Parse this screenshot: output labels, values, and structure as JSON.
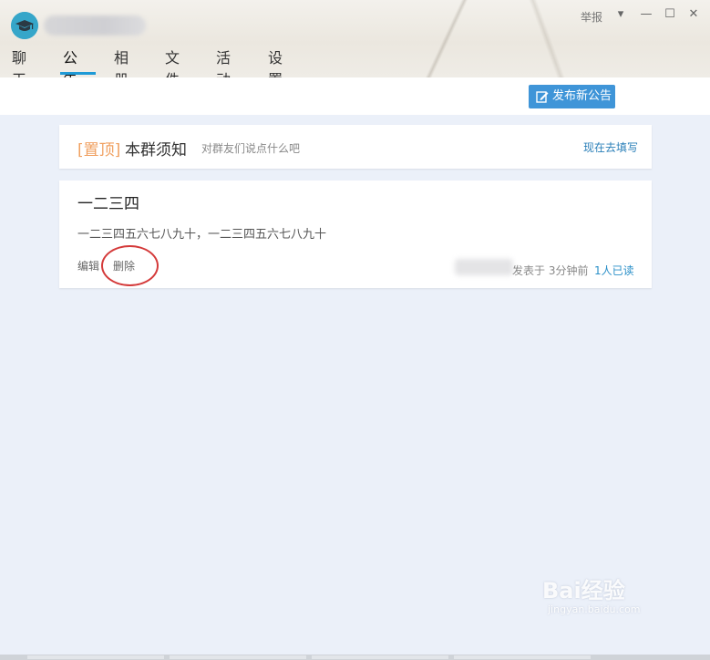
{
  "titlebar": {
    "report_label": "举报",
    "controls": {
      "dropdown": "▾",
      "minimize": "—",
      "maximize": "☐",
      "close": "✕"
    }
  },
  "tabs": [
    {
      "label": "聊天"
    },
    {
      "label": "公告"
    },
    {
      "label": "相册"
    },
    {
      "label": "文件"
    },
    {
      "label": "活动"
    },
    {
      "label": "设置"
    }
  ],
  "active_tab": "公告",
  "toolbar": {
    "publish_label": "发布新公告"
  },
  "pinned": {
    "tag": "[置顶]",
    "title": "本群须知",
    "hint": "对群友们说点什么吧",
    "fill_link": "现在去填写"
  },
  "notice": {
    "title": "一二三四",
    "body": "一二三四五六七八九十，一二三四五六七八九十",
    "edit_label": "编辑",
    "delete_label": "删除",
    "posted": "发表于  3分钟前",
    "reads": "1人已读"
  },
  "watermark": {
    "top": "Bai经验",
    "bottom": "jingyan.baidu.com"
  },
  "colors": {
    "accent": "#3f95d8",
    "tab_underline": "#1f9ad6",
    "pinned_tag": "#f0a060",
    "link": "#2a7fb8",
    "content_bg": "#ebf0f9",
    "highlight_circle": "#d43a3a"
  }
}
